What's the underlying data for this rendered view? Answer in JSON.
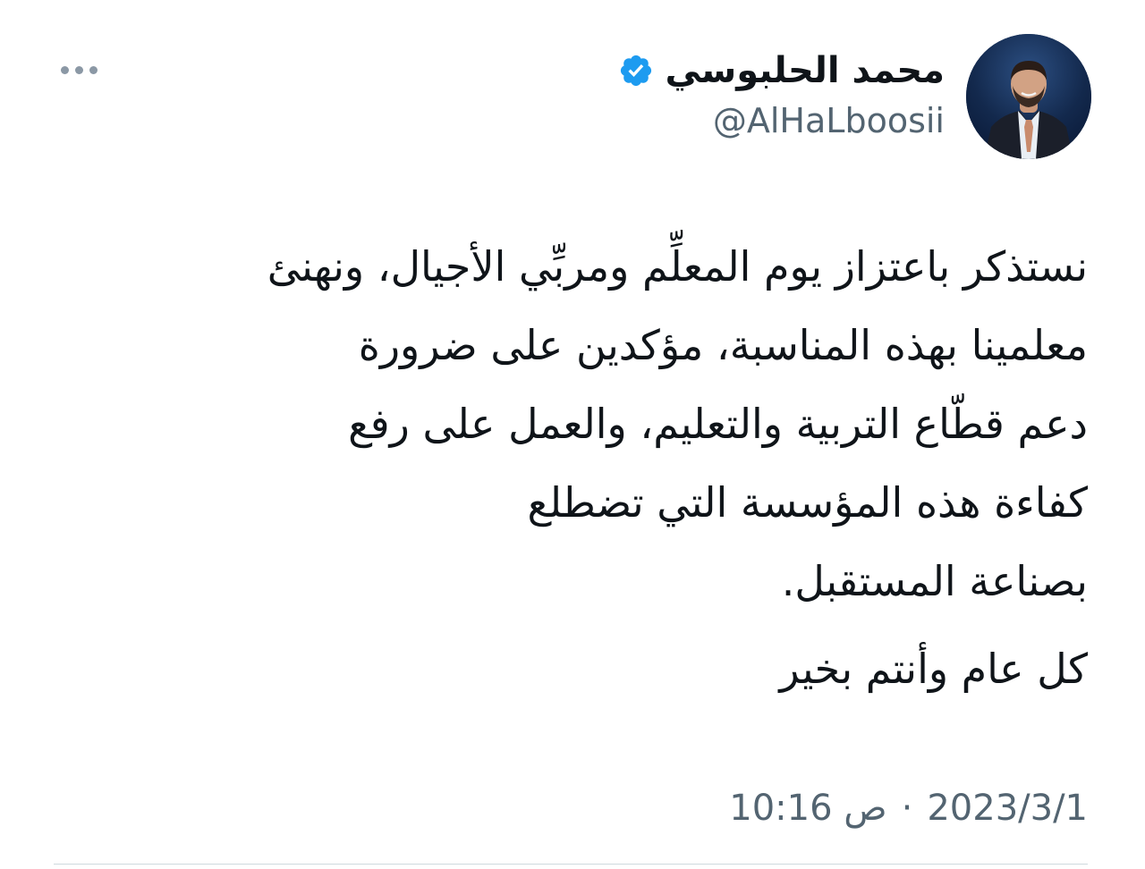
{
  "author": {
    "display_name": "محمد الحلبوسي",
    "handle": "@AlHaLboosii",
    "verified": true,
    "avatar_icon": "profile-photo",
    "verified_icon": "verified-badge-icon"
  },
  "menu": {
    "more_icon": "more-horizontal-icon"
  },
  "tweet": {
    "lines": [
      "نستذكر باعتزاز يوم المعلِّم ومربِّي الأجيال، ونهنئ",
      "معلمينا بهذه المناسبة، مؤكدين على ضرورة",
      "دعم قطّاع التربية والتعليم، والعمل على رفع",
      "كفاءة هذه المؤسسة التي تضطلع",
      "بصناعة المستقبل."
    ],
    "closing": "كل عام وأنتم بخير"
  },
  "meta": {
    "time": "10:16 ص",
    "separator": "·",
    "date": "2023/3/1"
  },
  "colors": {
    "text": "#0f1419",
    "secondary": "#536471",
    "verified": "#1d9bf0",
    "dots": "#8b98a5",
    "divider": "#cfd9de"
  }
}
